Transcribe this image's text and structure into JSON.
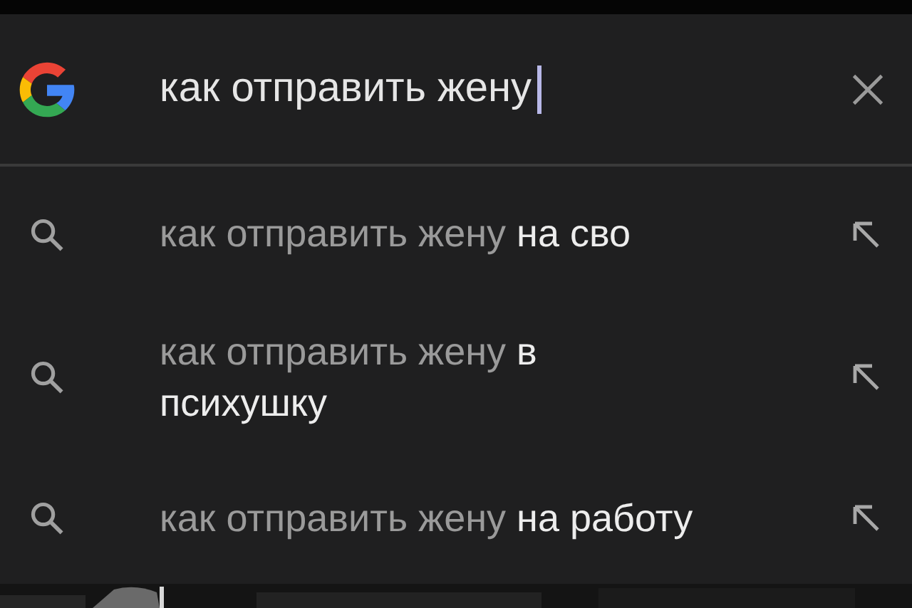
{
  "search": {
    "value": "как отправить жену"
  },
  "suggestions": [
    {
      "query": "как отправить жену",
      "completion": "на сво"
    },
    {
      "query": "как отправить жену",
      "completion": "в психушку"
    },
    {
      "query": "как отправить жену",
      "completion": "на работу"
    }
  ]
}
